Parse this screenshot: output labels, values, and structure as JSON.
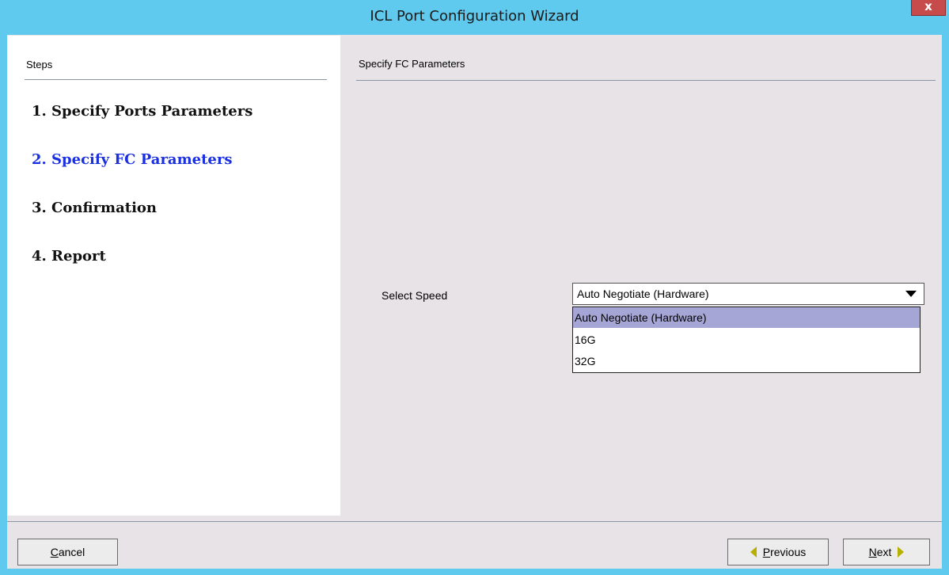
{
  "window": {
    "title": "ICL Port Configuration Wizard",
    "close_glyph": "x"
  },
  "steps": {
    "heading": "Steps",
    "items": [
      "1. Specify Ports Parameters",
      "2. Specify FC Parameters",
      "3. Confirmation",
      "4. Report"
    ],
    "active_index": 1,
    "active_color": "#1a2fe0"
  },
  "main": {
    "heading": "Specify FC Parameters",
    "speed_label": "Select Speed",
    "speed_select": {
      "value": "Auto Negotiate (Hardware)",
      "options": [
        "Auto Negotiate (Hardware)",
        "16G",
        "32G"
      ],
      "selected_index": 0,
      "expanded": true
    }
  },
  "footer": {
    "cancel": {
      "mnemonic": "C",
      "rest": "ancel"
    },
    "previous": {
      "mnemonic": "P",
      "rest": "revious"
    },
    "next": {
      "mnemonic": "N",
      "rest": "ext"
    }
  },
  "icons": {
    "previous_arrow": "triangle-left",
    "next_arrow": "triangle-right",
    "dropdown": "caret-down"
  },
  "colors": {
    "title_bar": "#5fc9ee",
    "selected_option": "#a6a6d6",
    "arrow": "#b7b000"
  }
}
